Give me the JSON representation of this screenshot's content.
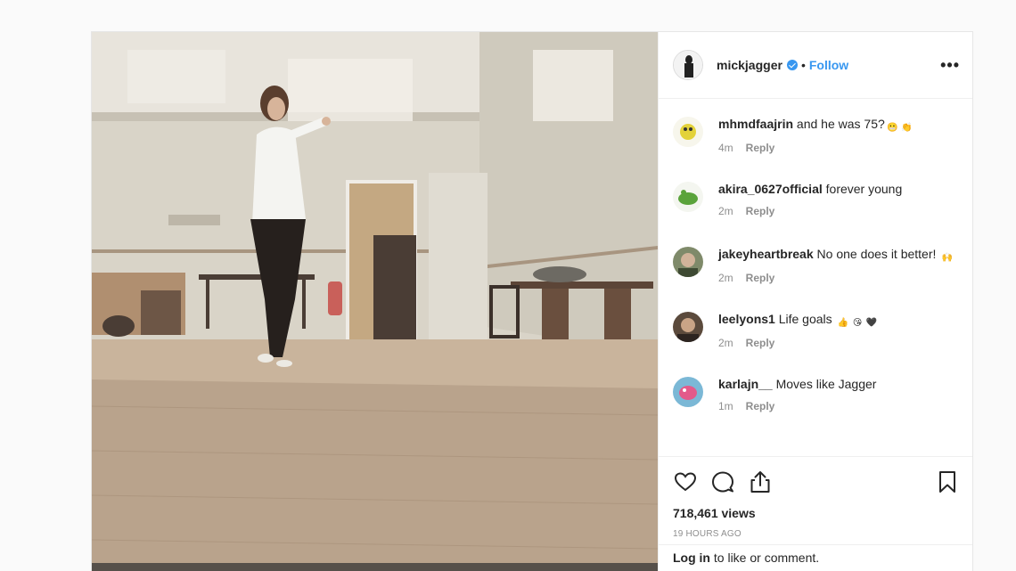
{
  "post": {
    "username": "mickjagger",
    "follow_label": "Follow",
    "dot": "•",
    "more_label": "•••",
    "views": "718,461 views",
    "time": "19 HOURS AGO",
    "login_link": "Log in",
    "login_rest": " to like or comment."
  },
  "comments": [
    {
      "user": "mhmdfaajrin",
      "text": " and he was 75?",
      "time": "4m",
      "reply": "Reply",
      "emojis": [
        "😬",
        "👏"
      ]
    },
    {
      "user": "akira_0627official",
      "text": " forever young",
      "time": "2m",
      "reply": "Reply",
      "emojis": []
    },
    {
      "user": "jakeyheartbreak",
      "text": " No one does it better! ",
      "time": "2m",
      "reply": "Reply",
      "emojis": [
        "🙌"
      ]
    },
    {
      "user": "leelyons1",
      "text": " Life goals ",
      "time": "2m",
      "reply": "Reply",
      "emojis": [
        "👍",
        "😘",
        "🖤"
      ]
    },
    {
      "user": "karlajn__",
      "text": " Moves like Jagger",
      "time": "1m",
      "reply": "Reply",
      "emojis": []
    }
  ],
  "icons": [
    "heart-icon",
    "comment-icon",
    "share-icon",
    "bookmark-icon",
    "verified-icon",
    "more-options-icon"
  ],
  "colors": {
    "accent": "#3897f0",
    "text": "#262626",
    "muted": "#8e8e8e",
    "border": "#efefef"
  }
}
